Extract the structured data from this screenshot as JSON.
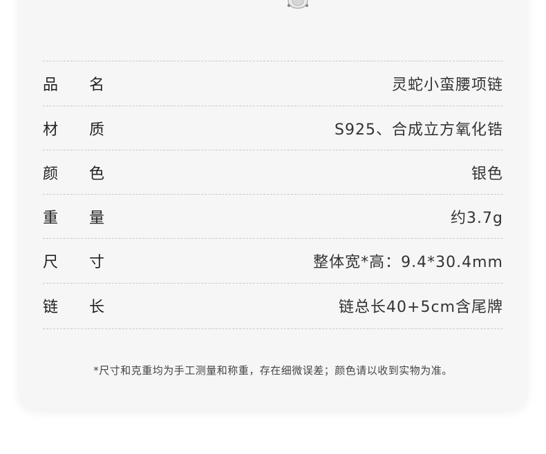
{
  "specs": [
    {
      "label_a": "品",
      "label_b": "名",
      "value": "灵蛇小蛮腰项链"
    },
    {
      "label_a": "材",
      "label_b": "质",
      "value": "S925、合成立方氧化锆"
    },
    {
      "label_a": "颜",
      "label_b": "色",
      "value": "银色"
    },
    {
      "label_a": "重",
      "label_b": "量",
      "value": "约3.7g"
    },
    {
      "label_a": "尺",
      "label_b": "寸",
      "value": "整体宽*高：9.4*30.4mm"
    },
    {
      "label_a": "链",
      "label_b": "长",
      "value": "链总长40+5cm含尾牌"
    }
  ],
  "note": "*尺寸和克重均为手工测量和称重，存在细微误差；颜色请以收到实物为准。",
  "colors": {
    "card_background": "#f6f6f6",
    "divider": "#c8c8c8",
    "text": "#222222"
  },
  "icons": {
    "top_image": "pendant-gem-icon"
  }
}
